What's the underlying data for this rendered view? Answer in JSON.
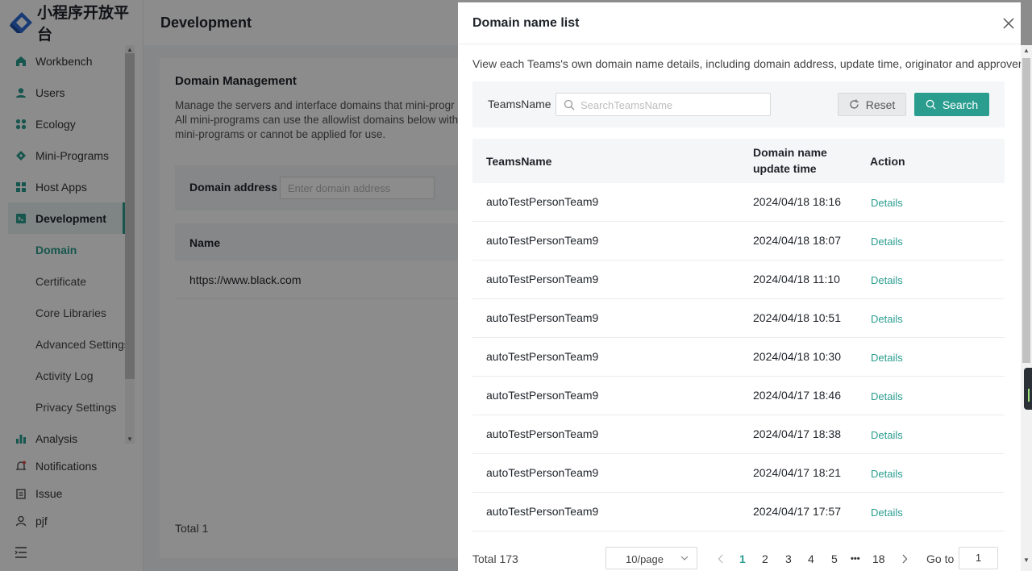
{
  "app": {
    "logo_text": "小程序开放平台",
    "page_title": "Development"
  },
  "sidebar": {
    "items": [
      {
        "label": "Workbench",
        "icon": "home-icon"
      },
      {
        "label": "Users",
        "icon": "user-icon"
      },
      {
        "label": "Ecology",
        "icon": "grid-icon"
      },
      {
        "label": "Mini-Programs",
        "icon": "diamond-icon"
      },
      {
        "label": "Host Apps",
        "icon": "apps-icon"
      },
      {
        "label": "Development",
        "icon": "code-icon"
      }
    ],
    "sub_items": [
      "Domain",
      "Certificate",
      "Core Libraries",
      "Advanced Settings",
      "Activity Log",
      "Privacy Settings"
    ],
    "lower_items": [
      {
        "label": "Analysis",
        "icon": "chart-icon"
      },
      {
        "label": "Notifications",
        "icon": "bell-icon"
      },
      {
        "label": "Issue",
        "icon": "clipboard-icon"
      },
      {
        "label": "pjf",
        "icon": "person-icon"
      }
    ]
  },
  "domain_management": {
    "title": "Domain Management",
    "description_lines": [
      "Manage the servers and interface domains that mini-progr",
      "All mini-programs can use the allowlist domains below with",
      "mini-programs or cannot be applied for use."
    ],
    "filter_label": "Domain address",
    "filter_placeholder": "Enter domain address",
    "column_name": "Name",
    "rows": [
      "https://www.black.com"
    ],
    "total": "Total 1"
  },
  "drawer": {
    "title": "Domain name list",
    "description": "View each Teams's own domain name details, including domain address, update time, originator and approver.",
    "filter_label": "TeamsName",
    "search_placeholder": "SearchTeamsName",
    "search_value": "",
    "reset_label": "Reset",
    "search_label": "Search",
    "columns": {
      "team": "TeamsName",
      "time": "Domain name update time",
      "action": "Action"
    },
    "rows": [
      {
        "team": "autoTestPersonTeam9",
        "time": "2024/04/18 18:16",
        "action": "Details"
      },
      {
        "team": "autoTestPersonTeam9",
        "time": "2024/04/18 18:07",
        "action": "Details"
      },
      {
        "team": "autoTestPersonTeam9",
        "time": "2024/04/18 11:10",
        "action": "Details"
      },
      {
        "team": "autoTestPersonTeam9",
        "time": "2024/04/18 10:51",
        "action": "Details"
      },
      {
        "team": "autoTestPersonTeam9",
        "time": "2024/04/18 10:30",
        "action": "Details"
      },
      {
        "team": "autoTestPersonTeam9",
        "time": "2024/04/17 18:46",
        "action": "Details"
      },
      {
        "team": "autoTestPersonTeam9",
        "time": "2024/04/17 18:38",
        "action": "Details"
      },
      {
        "team": "autoTestPersonTeam9",
        "time": "2024/04/17 18:21",
        "action": "Details"
      },
      {
        "team": "autoTestPersonTeam9",
        "time": "2024/04/17 17:57",
        "action": "Details"
      }
    ],
    "pagination": {
      "total": "Total 173",
      "page_size": "10/page",
      "pages": [
        "1",
        "2",
        "3",
        "4",
        "5"
      ],
      "ellipsis": "•••",
      "last_page": "18",
      "current": "1",
      "goto_label": "Go to",
      "goto_value": "1"
    }
  },
  "colors": {
    "accent": "#2a9d8f",
    "mask": "rgba(0,0,0,0.45)"
  }
}
